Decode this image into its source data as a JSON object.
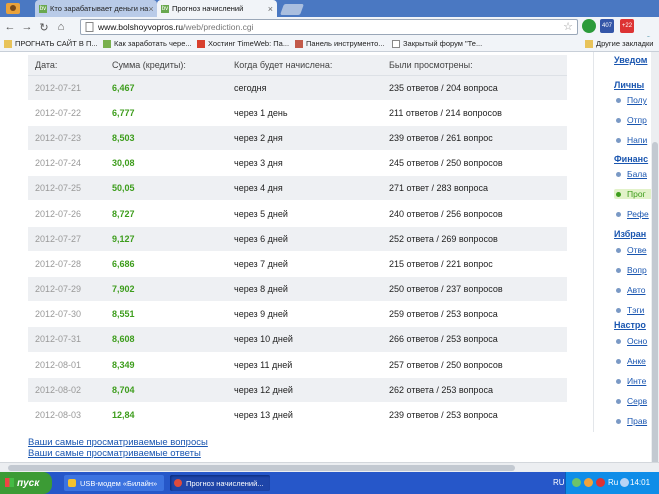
{
  "tabs": [
    {
      "label": "Кто зарабатывает деньги на",
      "active": false
    },
    {
      "label": "Прогноз начислений",
      "active": true
    }
  ],
  "address": {
    "host": "www.bolshoyvopros.ru",
    "path": "/web/prediction.cgi"
  },
  "extensions": {
    "counter1": "407",
    "counter2": "+22"
  },
  "bookmarks": [
    "ПРОГНАТЬ САЙТ В П...",
    "Как заработать чере...",
    "Хостинг TimeWeb: Па...",
    "Панель инструменто...",
    "Закрытый форум \"Те...",
    "Другие закладки"
  ],
  "table": {
    "headers": [
      "Дата:",
      "Сумма (кредиты):",
      "Когда будет начислена:",
      "Были просмотрены:"
    ],
    "rows": [
      [
        "2012-07-21",
        "6,467",
        "сегодня",
        "235 ответов / 204 вопроса"
      ],
      [
        "2012-07-22",
        "6,777",
        "через 1 день",
        "211 ответов / 214 вопросов"
      ],
      [
        "2012-07-23",
        "8,503",
        "через 2 дня",
        "239 ответов / 261 вопрос"
      ],
      [
        "2012-07-24",
        "30,08",
        "через 3 дня",
        "245 ответов / 250 вопросов"
      ],
      [
        "2012-07-25",
        "50,05",
        "через 4 дня",
        "271 ответ / 283 вопроса"
      ],
      [
        "2012-07-26",
        "8,727",
        "через 5 дней",
        "240 ответов / 256 вопросов"
      ],
      [
        "2012-07-27",
        "9,127",
        "через 6 дней",
        "252 ответа / 269 вопросов"
      ],
      [
        "2012-07-28",
        "6,686",
        "через 7 дней",
        "215 ответов / 221 вопрос"
      ],
      [
        "2012-07-29",
        "7,902",
        "через 8 дней",
        "250 ответов / 237 вопросов"
      ],
      [
        "2012-07-30",
        "8,551",
        "через 9 дней",
        "259 ответов / 253 вопроса"
      ],
      [
        "2012-07-31",
        "8,608",
        "через 10 дней",
        "266 ответов / 253 вопроса"
      ],
      [
        "2012-08-01",
        "8,349",
        "через 11 дней",
        "257 ответов / 250 вопросов"
      ],
      [
        "2012-08-02",
        "8,704",
        "через 12 дней",
        "262 ответа / 253 вопроса"
      ],
      [
        "2012-08-03",
        "12,84",
        "через 13 дней",
        "239 ответов / 253 вопроса"
      ]
    ]
  },
  "links": [
    "Ваши самые просматриваемые вопросы",
    "Ваши самые просматриваемые ответы"
  ],
  "sidebar": {
    "sections": [
      {
        "title": "Уведом",
        "items": []
      },
      {
        "title": "Личны",
        "items": [
          "Полу",
          "Отпр",
          "Напи"
        ]
      },
      {
        "title": "Финанс",
        "items": [
          "Бала",
          "Прог",
          "Рефе"
        ]
      },
      {
        "title": "Избран",
        "items": [
          "Отве",
          "Вопр",
          "Авто",
          "Тэги"
        ]
      },
      {
        "title": "Настро",
        "items": [
          "Осно",
          "Анке",
          "Инте",
          "Серв",
          "Прав"
        ]
      }
    ],
    "active_item": "Прог"
  },
  "taskbar": {
    "start": "пуск",
    "tasks": [
      "USB-модем «Билайн»",
      "Прогноз начислений..."
    ],
    "lang": "RU",
    "tray_lang": "Ru",
    "clock": "14:01"
  },
  "colors": {
    "accent_green": "#3d9d1c",
    "link_blue": "#1a56b0",
    "row_alt": "#eef0f3"
  }
}
